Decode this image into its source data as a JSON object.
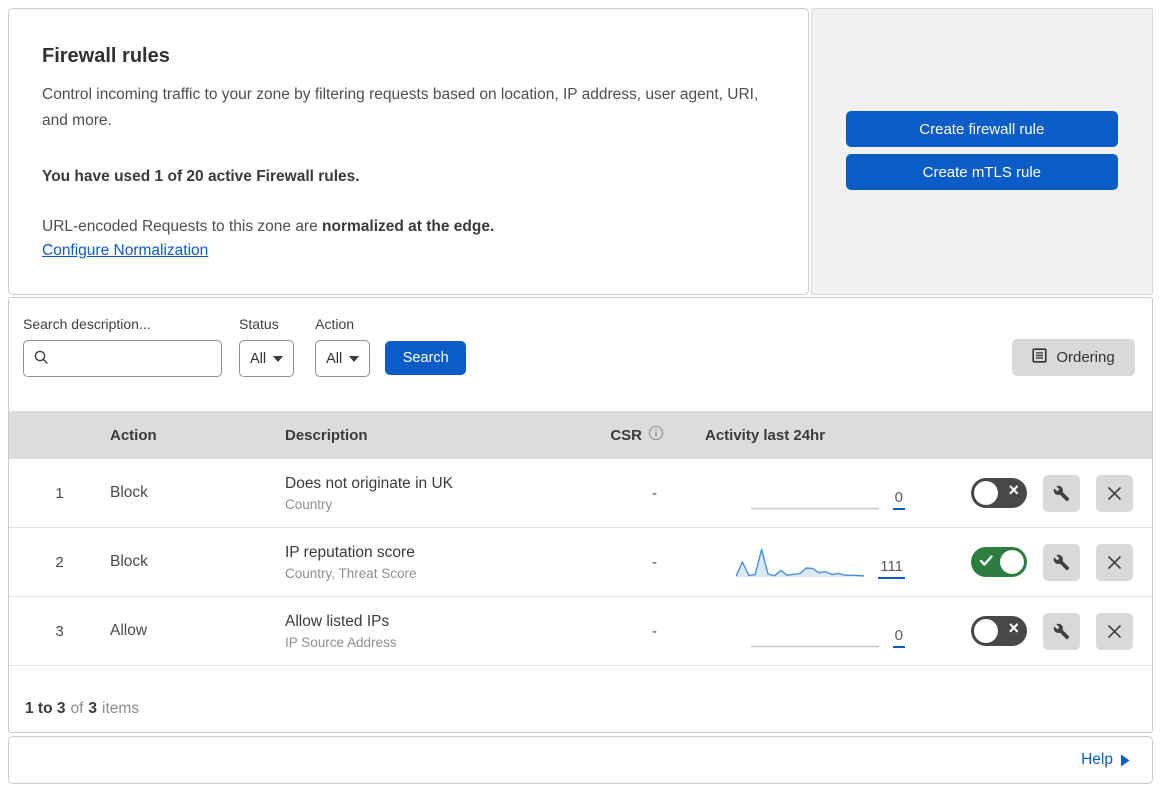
{
  "header": {
    "title": "Firewall rules",
    "description": "Control incoming traffic to your zone by filtering requests based on location, IP address, user agent, URI, and more.",
    "usage_notice": "You have used 1 of 20 active Firewall rules.",
    "normalization_prefix": "URL-encoded Requests to this zone are ",
    "normalization_bold": "normalized at the edge.",
    "normalization_link": "Configure Normalization",
    "create_firewall_button": "Create firewall rule",
    "create_mtls_button": "Create mTLS rule"
  },
  "filters": {
    "search_label": "Search description...",
    "search_value": "",
    "status_label": "Status",
    "status_value": "All",
    "action_label": "Action",
    "action_value": "All",
    "search_button": "Search",
    "ordering_button": "Ordering"
  },
  "table": {
    "columns": {
      "action": "Action",
      "description": "Description",
      "csr": "CSR",
      "activity": "Activity last 24hr"
    },
    "rows": [
      {
        "priority": "1",
        "action": "Block",
        "description": "Does not originate in UK",
        "criteria": "Country",
        "csr": "-",
        "activity_count": "0",
        "enabled": false,
        "sparkline": []
      },
      {
        "priority": "2",
        "action": "Block",
        "description": "IP reputation score",
        "criteria": "Country, Threat Score",
        "csr": "-",
        "activity_count": "111",
        "enabled": true,
        "sparkline": [
          2,
          50,
          5,
          8,
          92,
          10,
          4,
          22,
          6,
          9,
          12,
          30,
          28,
          14,
          18,
          8,
          12,
          6,
          6,
          5,
          4
        ]
      },
      {
        "priority": "3",
        "action": "Allow",
        "description": "Allow listed IPs",
        "criteria": "IP Source Address",
        "csr": "-",
        "activity_count": "0",
        "enabled": false,
        "sparkline": []
      }
    ]
  },
  "pagination": {
    "range": "1 to 3",
    "of_word": "of",
    "total": "3",
    "items_word": "items"
  },
  "footer": {
    "help_label": "Help"
  },
  "icons": {
    "search": "magnifier-glyph",
    "dropdown": "caret-down-triangle",
    "ordering": "document-lines",
    "info": "circled-i",
    "toggle_on": "checkmark",
    "toggle_off": "x-mark",
    "configure": "wrench",
    "delete": "x-mark",
    "help_arrow": "right-triangle"
  },
  "colors": {
    "accent_blue": "#0b5cc7",
    "toggle_on_green": "#2e7d40",
    "toggle_off_gray": "#47484a",
    "sparkline_line": "#4a8fdc",
    "sparkline_fill": "#dce9f9",
    "table_header_bg": "#dcdcdc",
    "panel_bg": "#f1f1f1",
    "icon_button_bg": "#d9d9d9"
  }
}
